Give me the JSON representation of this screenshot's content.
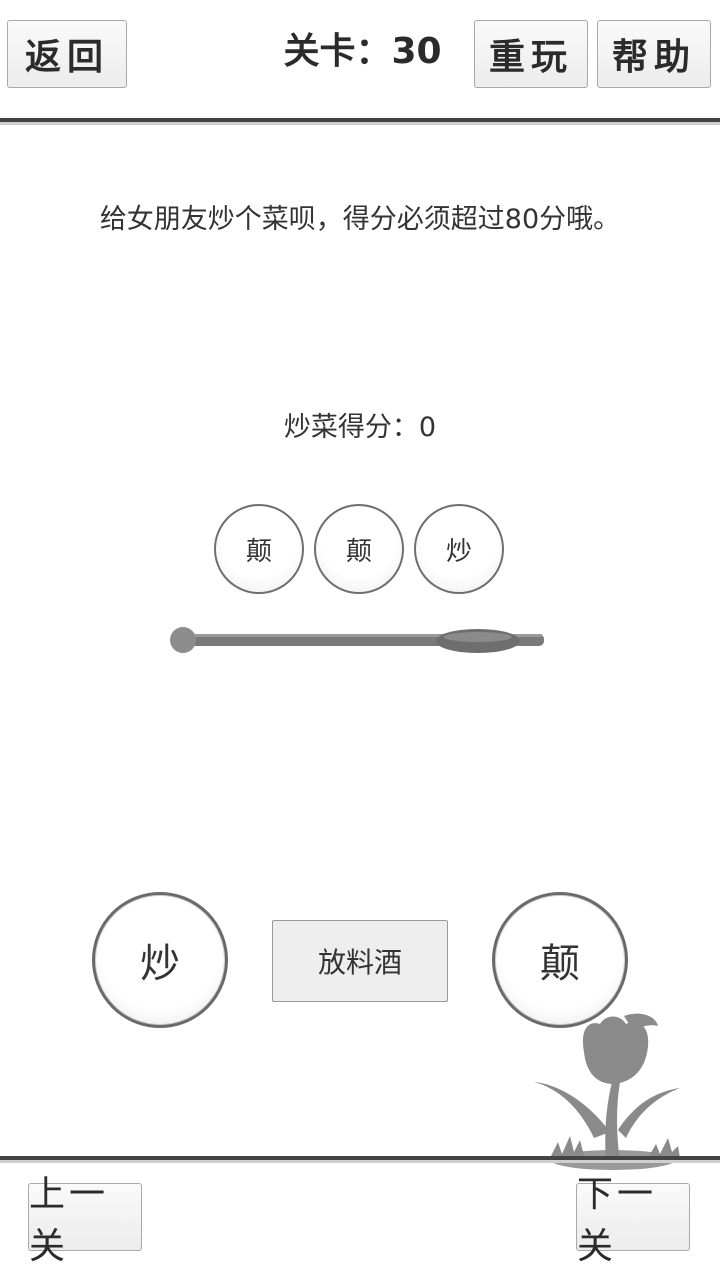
{
  "header": {
    "back_label": "返回",
    "level_label": "关卡：",
    "level_number": "30",
    "replay_label": "重玩",
    "help_label": "帮助"
  },
  "puzzle": {
    "instruction": "给女朋友炒个菜呗，得分必须超过80分哦。",
    "score_label": "炒菜得分：",
    "score_value": "0",
    "sequence": [
      "颠",
      "颠",
      "炒"
    ],
    "progress_fraction": 0.82
  },
  "actions": {
    "stir_fry_label": "炒",
    "add_wine_label": "放料酒",
    "toss_label": "颠"
  },
  "footer": {
    "prev_label": "上一关",
    "next_label": "下一关"
  },
  "colors": {
    "progress_track": "#7a7a7a",
    "progress_knob": "#8c8c8c",
    "decoration": "#8a8a8a"
  },
  "icons": {
    "decoration": "tulip-icon"
  }
}
